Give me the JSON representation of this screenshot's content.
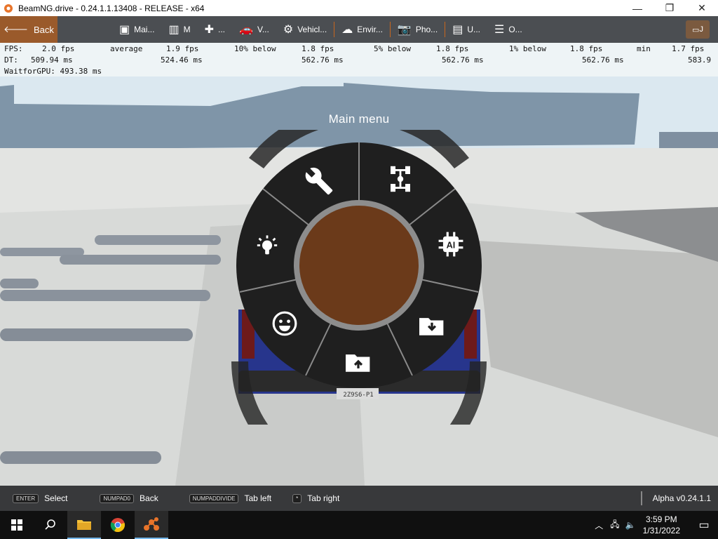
{
  "window": {
    "title": "BeamNG.drive - 0.24.1.1.13408 - RELEASE - x64",
    "minimize": "—",
    "maximize": "❐",
    "close": "✕"
  },
  "topbar": {
    "back_label": "Back",
    "tabs": [
      {
        "icon": "grid-icon",
        "label": "Mai..."
      },
      {
        "icon": "map-icon",
        "label": "M"
      },
      {
        "icon": "puzzle-icon",
        "label": "..."
      },
      {
        "icon": "car-icon",
        "label": "V..."
      },
      {
        "icon": "engine-icon",
        "label": "Vehicl..."
      },
      {
        "icon": "weather-icon",
        "label": "Envir..."
      },
      {
        "icon": "camera-icon",
        "label": "Pho..."
      },
      {
        "icon": "ui-apps-icon",
        "label": "U..."
      },
      {
        "icon": "sliders-icon",
        "label": "O..."
      }
    ],
    "right_button_label": "J"
  },
  "perf": {
    "row1": [
      "FPS:",
      "2.0 fps",
      "average",
      "1.9 fps",
      "10% below",
      "1.8 fps",
      "5% below",
      "1.8 fps",
      "1% below",
      "1.8 fps",
      "min",
      "1.7 fps"
    ],
    "row2": [
      "DT:",
      "509.94 ms",
      "524.46 ms",
      "562.76 ms",
      "562.76 ms",
      "562.76 ms",
      "583.9"
    ],
    "row3": "WaitforGPU: 493.38 ms"
  },
  "radial_menu": {
    "title": "Main menu",
    "center_color": "#6b3a1a",
    "segments": [
      "wrench-icon",
      "chassis-icon",
      "ai-icon",
      "load-folder-icon",
      "save-folder-icon",
      "emoji-icon",
      "lightbulb-icon"
    ]
  },
  "vehicle": {
    "plate": "2Z9S6-P1"
  },
  "bottombar": {
    "hints": [
      {
        "key": "ENTER",
        "label": "Select"
      },
      {
        "key": "NUMPAD0",
        "label": "Back"
      },
      {
        "key": "NUMPADDIVIDE",
        "label": "Tab left"
      },
      {
        "key": "*",
        "label": "Tab right"
      }
    ],
    "version": "Alpha v0.24.1.1"
  },
  "taskbar": {
    "time": "3:59 PM",
    "date": "1/31/2022"
  },
  "colors": {
    "accent": "#c7671e",
    "back_bg": "#9a5a2b"
  }
}
